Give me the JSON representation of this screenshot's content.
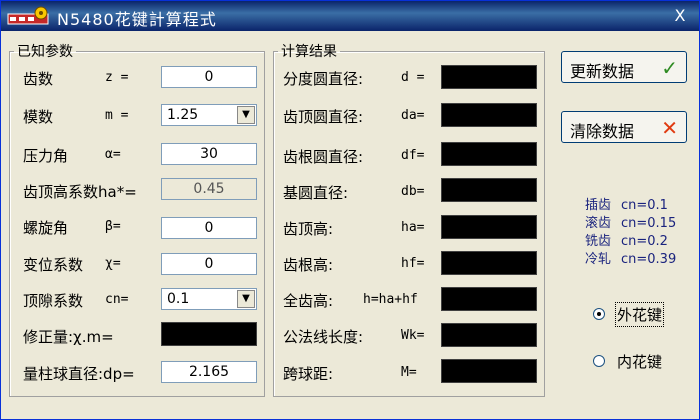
{
  "window": {
    "title": "N5480花键計算程式",
    "close_label": "X"
  },
  "known": {
    "legend": "已知参数",
    "rows": [
      {
        "label": "齿数",
        "sym": "z =",
        "value": "0"
      },
      {
        "label": "模数",
        "sym": "m =",
        "value": "1.25"
      },
      {
        "label": "压力角",
        "sym": "α=",
        "value": "30"
      },
      {
        "label": "齿顶高系数ha*=",
        "sym": "",
        "value": "0.45"
      },
      {
        "label": "螺旋角",
        "sym": "β=",
        "value": "0"
      },
      {
        "label": "变位系数",
        "sym": "χ=",
        "value": "0"
      },
      {
        "label": "顶隙系数",
        "sym": "cn=",
        "value": "0.1"
      },
      {
        "label": "修正量:χ.m=",
        "sym": "",
        "value": ""
      },
      {
        "label": "量柱球直径:dp=",
        "sym": "",
        "value": "2.165"
      }
    ]
  },
  "result": {
    "legend": "计算结果",
    "rows": [
      {
        "label": "分度圆直径:",
        "sym": "d ="
      },
      {
        "label": "齿顶圆直径:",
        "sym": "da="
      },
      {
        "label": "齿根圆直径:",
        "sym": "df="
      },
      {
        "label": "基圆直径:",
        "sym": "db="
      },
      {
        "label": "齿顶高:",
        "sym": "ha="
      },
      {
        "label": "齿根高:",
        "sym": "hf="
      },
      {
        "label": "全齿高:",
        "sym": "h=ha+hf"
      },
      {
        "label": "公法线长度:",
        "sym": "Wk="
      },
      {
        "label": "跨球距:",
        "sym": "M="
      }
    ]
  },
  "buttons": {
    "update": "更新数据",
    "clear": "清除数据",
    "update_icon": "✓",
    "clear_icon": "✕"
  },
  "clearance_table": [
    {
      "method": "插齿",
      "value": "cn=0.1"
    },
    {
      "method": "滚齿",
      "value": "cn=0.15"
    },
    {
      "method": "铣齿",
      "value": "cn=0.2"
    },
    {
      "method": "冷轧",
      "value": "cn=0.39"
    }
  ],
  "spline_type": {
    "options": [
      "外花键",
      "内花键"
    ],
    "selected": "外花键"
  },
  "colors": {
    "title_bar": "#0a246a",
    "accept_icon": "#2e8b22",
    "cancel_icon": "#e03a10"
  },
  "icons": {
    "app": "gear-app-icon",
    "update": "check-icon",
    "clear": "cross-icon"
  }
}
